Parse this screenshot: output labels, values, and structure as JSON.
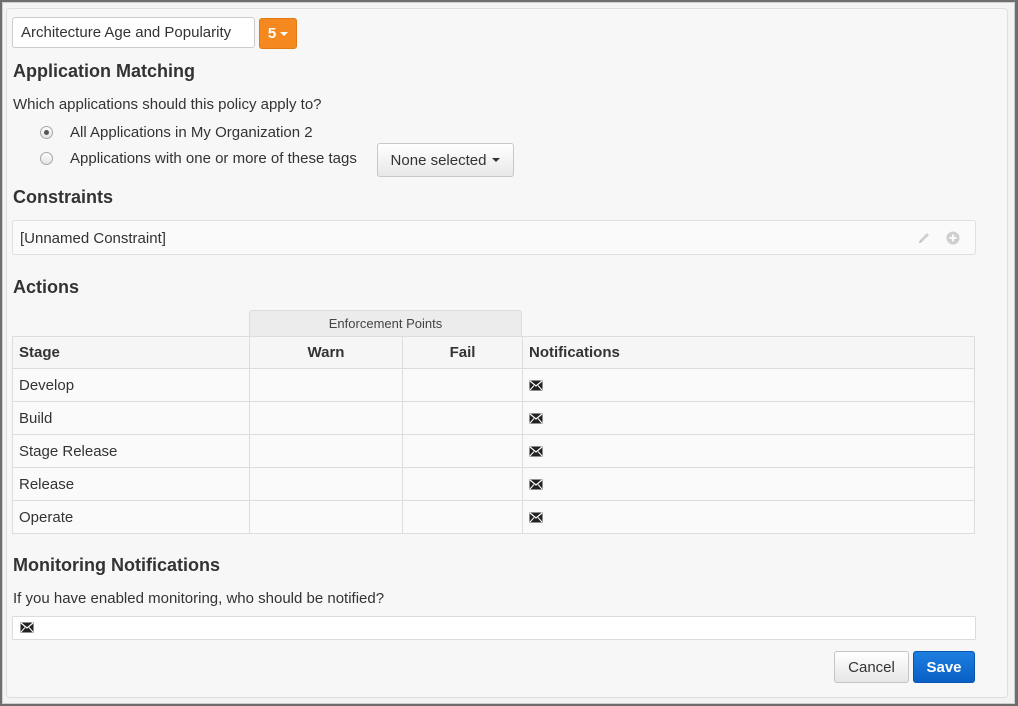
{
  "policy": {
    "name_value": "Architecture Age and Popularity",
    "threat_level": "5",
    "threat_color": "#f5891f"
  },
  "application_matching": {
    "heading": "Application Matching",
    "question": "Which applications should this policy apply to?",
    "options": [
      {
        "label": "All Applications in My Organization 2",
        "selected": true
      },
      {
        "label": "Applications with one or more of these tags",
        "selected": false
      }
    ],
    "tags_dropdown": "None selected"
  },
  "constraints": {
    "heading": "Constraints",
    "items": [
      {
        "label": "[Unnamed Constraint]",
        "icons": [
          "pencil-icon",
          "plus-circle-icon"
        ]
      }
    ]
  },
  "actions": {
    "heading": "Actions",
    "group_header": "Enforcement Points",
    "columns": [
      "Stage",
      "Warn",
      "Fail",
      "Notifications"
    ],
    "rows": [
      {
        "stage": "Develop",
        "warn": "",
        "fail": "",
        "notification_icon": "envelope-icon"
      },
      {
        "stage": "Build",
        "warn": "",
        "fail": "",
        "notification_icon": "envelope-icon"
      },
      {
        "stage": "Stage Release",
        "warn": "",
        "fail": "",
        "notification_icon": "envelope-icon"
      },
      {
        "stage": "Release",
        "warn": "",
        "fail": "",
        "notification_icon": "envelope-icon"
      },
      {
        "stage": "Operate",
        "warn": "",
        "fail": "",
        "notification_icon": "envelope-icon"
      }
    ]
  },
  "monitoring": {
    "heading": "Monitoring Notifications",
    "question": "If you have enabled monitoring, who should be notified?",
    "icon": "envelope-icon"
  },
  "buttons": {
    "cancel": "Cancel",
    "save": "Save",
    "save_color": "#0a6fd6"
  }
}
